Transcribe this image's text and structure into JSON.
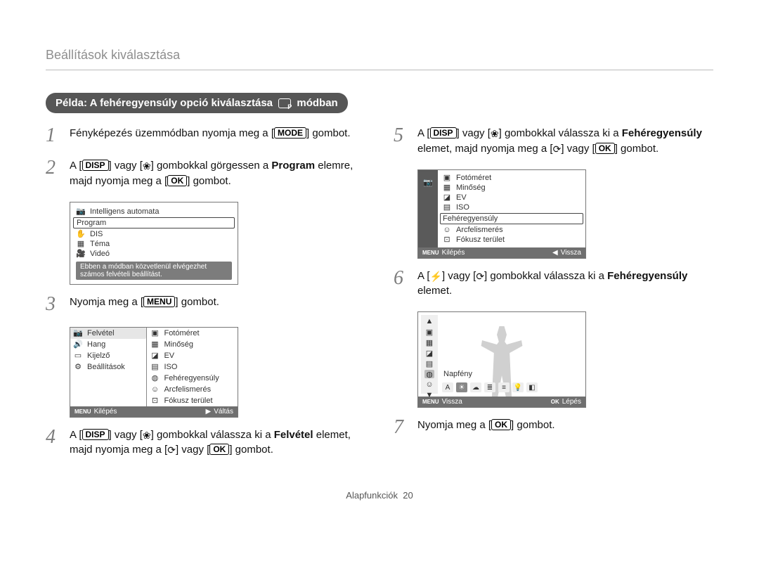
{
  "header": {
    "breadcrumb": "Beállítások kiválasztása"
  },
  "pill": {
    "prefix": "Példa: A fehéregyensúly opció kiválasztása",
    "suffix": "módban"
  },
  "buttons": {
    "mode": "MODE",
    "disp": "DISP",
    "ok": "OK",
    "menu": "MENU"
  },
  "glyphs": {
    "flower": "❀",
    "timer": "⟳",
    "flash": "⚡",
    "play": "▶",
    "back": "◀",
    "up": "▲",
    "down": "▼"
  },
  "steps": {
    "s1": {
      "num": "1",
      "t1": "Fényképezés üzemmódban nyomja meg a [",
      "t2": "] gombot."
    },
    "s2": {
      "num": "2",
      "t1": "A [",
      "t2": "] vagy [",
      "t3": "] gombokkal görgessen a ",
      "bold": "Program",
      "t4": " elemre, majd nyomja meg a [",
      "t5": "] gombot."
    },
    "s3": {
      "num": "3",
      "t1": "Nyomja meg a [",
      "t2": "] gombot."
    },
    "s4": {
      "num": "4",
      "t1": "A [",
      "t2": "] vagy [",
      "t3": "] gombokkal válassza ki a ",
      "bold": "Felvétel",
      "t4": " elemet, majd nyomja meg a [",
      "t5": "] vagy [",
      "t6": "] gombot."
    },
    "s5": {
      "num": "5",
      "t1": "A [",
      "t2": "] vagy [",
      "t3": "] gombokkal válassza ki a ",
      "bold": "Fehéregyensúly",
      "t4": " elemet, majd nyomja meg a [",
      "t5": "] vagy [",
      "t6": "] gombot."
    },
    "s6": {
      "num": "6",
      "t1": "A [",
      "t2": "] vagy [",
      "t3": "] gombokkal válassza ki a ",
      "bold": "Fehéregyensúly",
      "t4": " elemet."
    },
    "s7": {
      "num": "7",
      "t1": "Nyomja meg a [",
      "t2": "] gombot."
    }
  },
  "lcd1": {
    "items": [
      "Intelligens automata",
      "Program",
      "DIS",
      "Téma",
      "Videó"
    ],
    "hint": "Ebben a módban közvetlenül elvégezhet számos felvételi beállítást."
  },
  "lcd2": {
    "left": [
      "Felvétel",
      "Hang",
      "Kijelző",
      "Beállítások"
    ],
    "right": [
      "Fotóméret",
      "Minőség",
      "EV",
      "ISO",
      "Fehéregyensúly",
      "Arcfelismerés",
      "Fókusz terület"
    ],
    "foot_l": "Kilépés",
    "foot_r": "Váltás"
  },
  "lcd3": {
    "items": [
      "Fotóméret",
      "Minőség",
      "EV",
      "ISO",
      "Fehéregyensúly",
      "Arcfelismerés",
      "Fókusz terület"
    ],
    "foot_l": "Kilépés",
    "foot_r": "Vissza"
  },
  "lcd4": {
    "label": "Napfény",
    "foot_l": "Vissza",
    "foot_r": "Lépés"
  },
  "footer": {
    "section": "Alapfunkciók",
    "page": "20"
  }
}
